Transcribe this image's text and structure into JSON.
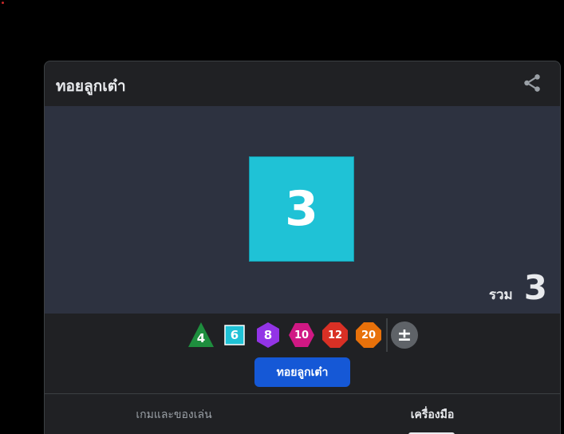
{
  "colors": {
    "page_background": "#000000",
    "card_background": "#202124",
    "stage_background": "#2d3240",
    "die_d6": "#1fc2d6",
    "die_d4": "#1e8e3e",
    "die_d8": "#9334e6",
    "die_d10": "#d01884",
    "die_d12": "#d93025",
    "die_d20": "#e8710a",
    "roll_button": "#1558d6"
  },
  "header": {
    "title": "ทอยลูกเต๋า",
    "share_icon": "share-icon"
  },
  "result": {
    "die_value": "3",
    "total_label": "รวม",
    "total_value": "3"
  },
  "dice": [
    {
      "label": "4",
      "shape": "triangle"
    },
    {
      "label": "6",
      "shape": "square"
    },
    {
      "label": "8",
      "shape": "hexagon"
    },
    {
      "label": "10",
      "shape": "hexagon"
    },
    {
      "label": "12",
      "shape": "octagon"
    },
    {
      "label": "20",
      "shape": "octagon"
    }
  ],
  "modifier_label": "±",
  "roll_button_label": "ทอยลูกเต๋า",
  "tabs": [
    {
      "label": "เกมและของเล่น",
      "selected": false
    },
    {
      "label": "เครื่องมือ",
      "selected": true
    }
  ]
}
